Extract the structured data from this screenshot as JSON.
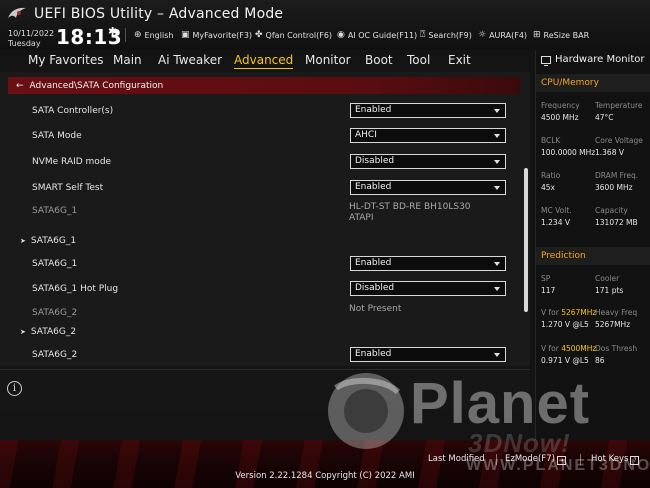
{
  "header": {
    "title": "UEFI BIOS Utility – Advanced Mode",
    "date": "10/11/2022",
    "weekday": "Tuesday",
    "time": "18:13",
    "toolbar": [
      {
        "label": "English",
        "icon": "globe-icon"
      },
      {
        "label": "MyFavorite(F3)",
        "icon": "favorite-icon"
      },
      {
        "label": "Qfan Control(F6)",
        "icon": "fan-icon"
      },
      {
        "label": "AI OC Guide(F11)",
        "icon": "ai-icon"
      },
      {
        "label": "Search(F9)",
        "icon": "search-icon"
      },
      {
        "label": "AURA(F4)",
        "icon": "aura-icon"
      },
      {
        "label": "ReSize BAR",
        "icon": "resize-bar-icon"
      }
    ]
  },
  "nav": {
    "tabs": [
      "My Favorites",
      "Main",
      "Ai Tweaker",
      "Advanced",
      "Monitor",
      "Boot",
      "Tool",
      "Exit"
    ],
    "active": "Advanced"
  },
  "breadcrumb": "Advanced\\SATA Configuration",
  "settings": [
    {
      "label": "SATA Controller(s)",
      "value": "Enabled"
    },
    {
      "label": "SATA Mode",
      "value": "AHCI"
    },
    {
      "label": "NVMe RAID mode",
      "value": "Disabled"
    },
    {
      "label": "SMART Self Test",
      "value": "Enabled"
    },
    {
      "label": "SATA6G_1",
      "info_line1": "HL-DT-ST BD-RE  BH10LS30",
      "info_line2": "ATAPI"
    },
    {
      "label": "SATA6G_1"
    },
    {
      "label": "SATA6G_1",
      "value": "Enabled"
    },
    {
      "label": "SATA6G_1 Hot Plug",
      "value": "Disabled"
    },
    {
      "label": "SATA6G_2",
      "info_line1": "Not Present"
    },
    {
      "label": "SATA6G_2"
    },
    {
      "label": "SATA6G_2",
      "value": "Enabled"
    }
  ],
  "hw_monitor": {
    "title": "Hardware Monitor",
    "cpu_memory": {
      "title": "CPU/Memory",
      "frequency_label": "Frequency",
      "frequency": "4500 MHz",
      "temperature_label": "Temperature",
      "temperature": "47°C",
      "bclk_label": "BCLK",
      "bclk": "100.0000 MHz",
      "core_voltage_label": "Core Voltage",
      "core_voltage": "1.368 V",
      "ratio_label": "Ratio",
      "ratio": "45x",
      "dram_freq_label": "DRAM Freq.",
      "dram_freq": "3600 MHz",
      "mc_volt_label": "MC Volt.",
      "mc_volt": "1.234 V",
      "capacity_label": "Capacity",
      "capacity": "131072 MB"
    },
    "prediction": {
      "title": "Prediction",
      "sp_label": "SP",
      "sp": "117",
      "cooler_label": "Cooler",
      "cooler": "171 pts",
      "v_for_label_prefix": "V for ",
      "v_for_freq_1": "5267MHz",
      "heavy_freq_label": "Heavy Freq",
      "v_for_value_1": "1.270 V @L5",
      "heavy_freq": "5267MHz",
      "v_for_freq_2": "4500MHz",
      "dos_thresh_label": "Dos Thresh",
      "v_for_value_2": "0.971 V @L5",
      "dos_thresh": "86"
    }
  },
  "footer": {
    "last_modified": "Last Modified",
    "ezmode": "EzMode(F7)",
    "hot_keys": "Hot Keys",
    "version": "Version 2.22.1284 Copyright (C) 2022 AMI"
  },
  "watermark": {
    "main": "Planet",
    "sub": "3DNow!",
    "url": "WWW.PLANET3DNOW.DE"
  },
  "colors": {
    "accent": "#f5c518",
    "section_title": "#f5a623",
    "breadcrumb_bg": "#6a0f12"
  }
}
